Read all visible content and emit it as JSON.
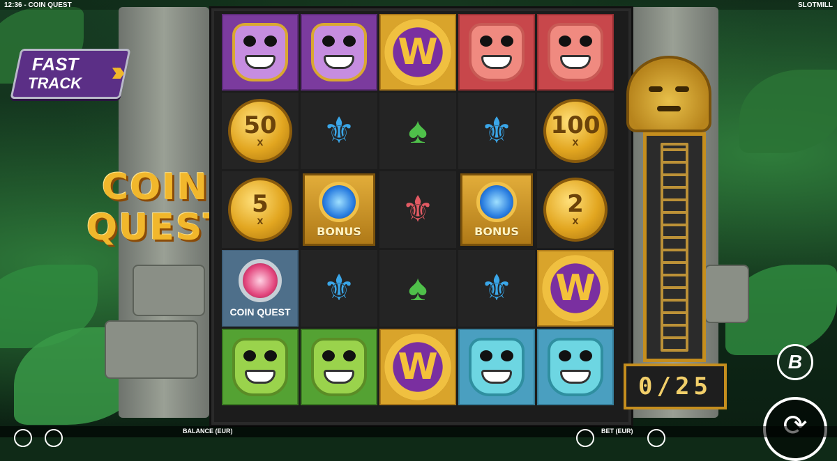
{
  "topbar": {
    "time_title": "12:36 - COIN QUEST",
    "brand": "SLOTMILL"
  },
  "fast_track": {
    "line1": "FAST",
    "line2": "TRACK"
  },
  "logo": {
    "line1": "COIN",
    "line2": "QUEST"
  },
  "counter": {
    "text": "0/25"
  },
  "buttons": {
    "b_logo": "B",
    "spin_icon": "⟳"
  },
  "bottom_bar": {
    "balance_label": "BALANCE (EUR)",
    "bet_label": "BET (EUR)"
  },
  "reels": [
    [
      {
        "type": "skull"
      },
      {
        "type": "skull"
      },
      {
        "type": "wild",
        "label": "W"
      },
      {
        "type": "pig"
      },
      {
        "type": "pig"
      }
    ],
    [
      {
        "type": "coin",
        "value": "50",
        "mult": "x"
      },
      {
        "type": "gem_blue"
      },
      {
        "type": "gem_green"
      },
      {
        "type": "gem_blue"
      },
      {
        "type": "coin",
        "value": "100",
        "mult": "x"
      }
    ],
    [
      {
        "type": "coin",
        "value": "5",
        "mult": "x"
      },
      {
        "type": "bonus",
        "label": "BONUS"
      },
      {
        "type": "gem_pink"
      },
      {
        "type": "bonus",
        "label": "BONUS"
      },
      {
        "type": "coin",
        "value": "2",
        "mult": "x"
      }
    ],
    [
      {
        "type": "coin_quest",
        "label": "COIN QUEST"
      },
      {
        "type": "gem_blue"
      },
      {
        "type": "gem_green"
      },
      {
        "type": "gem_blue"
      },
      {
        "type": "wild",
        "label": "W"
      }
    ],
    [
      {
        "type": "monkey"
      },
      {
        "type": "monkey"
      },
      {
        "type": "wild",
        "label": "W"
      },
      {
        "type": "snake"
      },
      {
        "type": "snake"
      }
    ]
  ],
  "colors": {
    "gold": "#f1b72c",
    "purple": "#7b3b9e",
    "red": "#c8474b",
    "green": "#54a233",
    "teal": "#4a9fc0"
  }
}
